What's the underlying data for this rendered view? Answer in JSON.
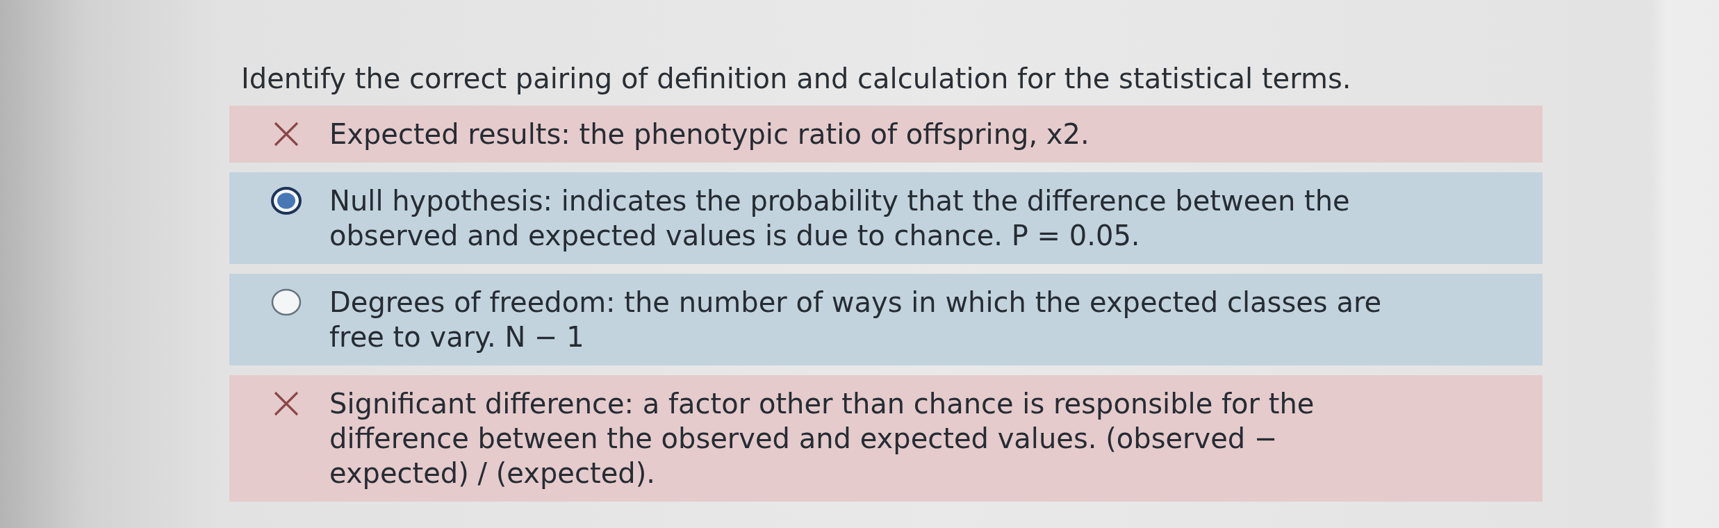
{
  "question": {
    "text": "Identify the correct pairing of definition and calculation for the statistical terms."
  },
  "options": [
    {
      "kind": "incorrect",
      "selected": false,
      "text": "Expected results: the phenotypic ratio of offspring, x2."
    },
    {
      "kind": "choice",
      "selected": true,
      "text": "Null hypothesis: indicates the probability that the difference between the\nobserved and expected values is due to chance. P = 0.05."
    },
    {
      "kind": "choice",
      "selected": false,
      "text": "Degrees of freedom: the number of ways in which the expected classes are\nfree to vary. N − 1"
    },
    {
      "kind": "incorrect",
      "selected": false,
      "text": "Significant difference: a factor other than chance is responsible for the\ndifference between the observed and expected values. (observed −\nexpected) / (expected)."
    }
  ]
}
